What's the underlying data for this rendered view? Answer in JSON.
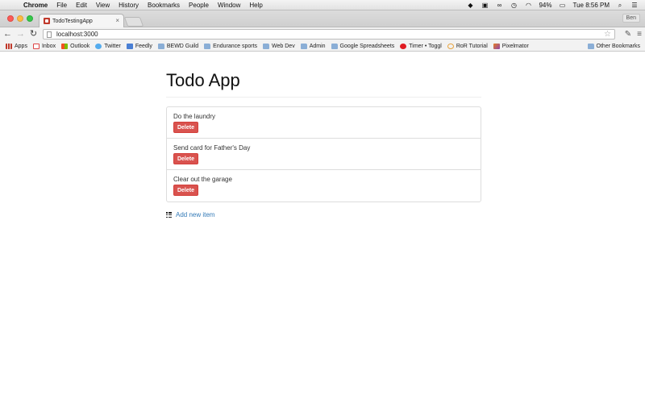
{
  "menubar": {
    "app": "Chrome",
    "items": [
      "File",
      "Edit",
      "View",
      "History",
      "Bookmarks",
      "People",
      "Window",
      "Help"
    ],
    "battery": "94%",
    "clock": "Tue 8:56 PM"
  },
  "tabs": {
    "active_title": "TodoTestingApp",
    "close_glyph": "×",
    "profile": "Ben"
  },
  "toolbar": {
    "url": "localhost:3000"
  },
  "bookmarks": {
    "items": [
      "Apps",
      "Inbox",
      "Outlook",
      "Twitter",
      "Feedly",
      "BEWD Guild",
      "Endurance sports",
      "Web Dev",
      "Admin",
      "Google Spreadsheets",
      "Timer • Toggl",
      "RoR Tutorial",
      "Pixelmator"
    ],
    "other": "Other Bookmarks"
  },
  "page": {
    "title": "Todo App",
    "todos": [
      {
        "text": "Do the laundry",
        "delete_label": "Delete"
      },
      {
        "text": "Send card for Father's Day",
        "delete_label": "Delete"
      },
      {
        "text": "Clear out the garage",
        "delete_label": "Delete"
      }
    ],
    "add_link": "Add new item"
  },
  "colors": {
    "delete_button": "#d9534f",
    "link": "#337ab7"
  }
}
